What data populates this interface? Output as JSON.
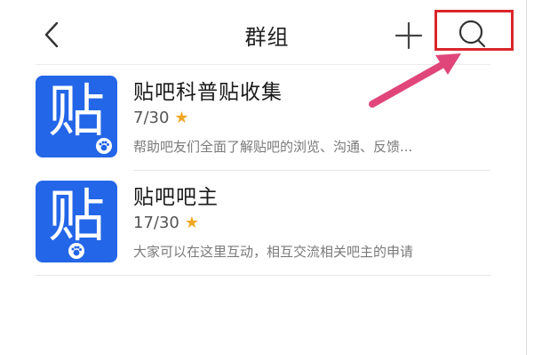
{
  "header": {
    "title": "群组",
    "back_icon": "chevron-left-icon",
    "add_icon": "plus-icon",
    "search_icon": "search-icon"
  },
  "annotation": {
    "highlight_color": "#d9262b",
    "arrow_color": "#e0467a"
  },
  "groups": [
    {
      "icon_char": "贴",
      "name": "贴吧科普贴收集",
      "count": "7/30",
      "star": "★",
      "description": "帮助吧友们全面了解贴吧的浏览、沟通、反馈..."
    },
    {
      "icon_char": "贴",
      "name": "贴吧吧主",
      "count": "17/30",
      "star": "★",
      "description": "大家可以在这里互动，相互交流相关吧主的申请"
    }
  ],
  "colors": {
    "icon_bg": "#2366e8",
    "star": "#f0a622"
  }
}
